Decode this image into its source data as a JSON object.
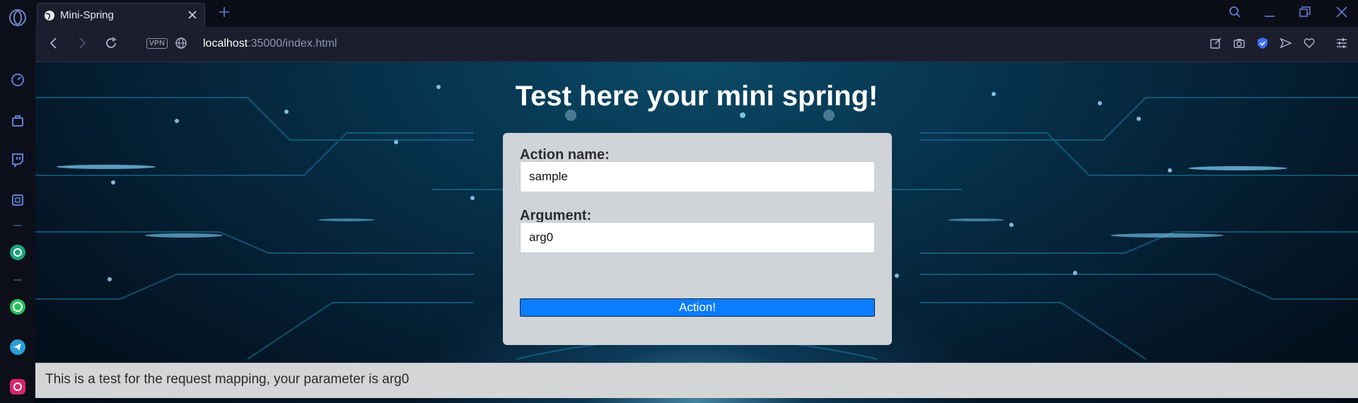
{
  "browser": {
    "tab": {
      "title": "Mini-Spring"
    },
    "address": {
      "vpn_label": "VPN",
      "host": "localhost",
      "rest": ":35000/index.html"
    }
  },
  "sidebar": {
    "items": [
      "speed-dial",
      "bag",
      "twitch",
      "workspaces",
      "chatgpt",
      "whatsapp",
      "telegram",
      "instagram"
    ]
  },
  "page": {
    "title": "Test here your mini spring!",
    "form": {
      "action_label": "Action name:",
      "action_value": "sample",
      "argument_label": "Argument:",
      "argument_value": "arg0",
      "button_label": "Action!"
    },
    "result_text": "This is a test for the request mapping, your parameter is arg0"
  },
  "colors": {
    "accent_button": "#0a7cff",
    "card_bg": "#d0d4d8",
    "browser_bg": "#0b0e17",
    "toolbar_bg": "#1b1f2d"
  }
}
